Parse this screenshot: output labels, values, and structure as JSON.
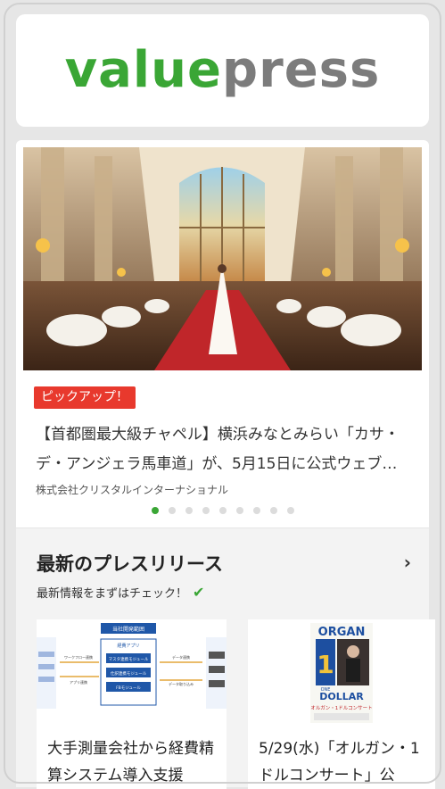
{
  "brand": {
    "logo_part1": "value",
    "logo_part2": "press"
  },
  "featured": {
    "badge": "ピックアップ！",
    "headline": "【首都圏最大級チャペル】横浜みなとみらい「カサ・デ・アンジェラ馬車道」が、5月15日に公式ウェブ…",
    "company": "株式会社クリスタルインターナショナル",
    "image_icon": "chapel-photo",
    "carousel": {
      "total": 9,
      "active_index": 0
    }
  },
  "latest": {
    "title": "最新のプレスリリース",
    "subtitle": "最新情報をまずはチェック！",
    "arrow_icon": "chevron-right-icon",
    "cards": [
      {
        "title": "大手測量会社から経費精算システム導入支援",
        "thumb_icon": "system-diagram-thumbnail",
        "thumb_text": {
          "header": "当社開発範囲",
          "system": "経費アプリ",
          "modules": [
            "マスタ連携モジュール",
            "仕訳連携モジュール",
            "FBモジュール"
          ],
          "left_label": "ワークフロー連携",
          "left_label2": "アプリ連携",
          "right_label": "データ連携",
          "right_label2": "データ取り込み"
        }
      },
      {
        "title": "5/29(水)「オルガン・1ドルコンサート」公",
        "thumb_icon": "organ-concert-poster",
        "thumb_text": {
          "top": "ORGAN",
          "one": "ONE",
          "dollar": "DOLLAR",
          "jp": "オルガン・1ドルコンサート"
        }
      }
    ]
  },
  "colors": {
    "brand_green": "#3aa635",
    "badge_red": "#e8392d",
    "logo_gray": "#7c7c7c"
  }
}
